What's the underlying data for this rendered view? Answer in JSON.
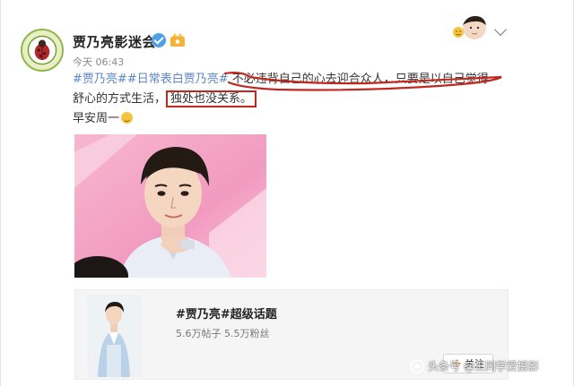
{
  "header": {
    "username": "贾乃亮影迷会",
    "timestamp": "今天 06:43"
  },
  "post": {
    "hashtag1": "#贾乃亮#",
    "hashtag2": "#日常表白贾乃亮#",
    "text1": "不必违背自己的心去迎合众人，只要是以自己觉得",
    "text2": "舒心的方式生活，",
    "boxed_text": "独处也没关系。",
    "text3": "早安周一"
  },
  "card": {
    "title": "#贾乃亮#超级话题",
    "stats": "5.6万帖子 5.5万粉丝",
    "follow_label": "关注"
  },
  "watermark": {
    "text": "头条号 @王同学爱摄影"
  },
  "colors": {
    "hashtag": "#5d86c4",
    "highlight_box": "#c0281f",
    "verified": "#4da0e8",
    "follow_plus": "#f08a24"
  },
  "icons": [
    "verified-icon",
    "vip-icon",
    "chevron-down-icon",
    "smile-emoji-icon",
    "plus-icon"
  ]
}
